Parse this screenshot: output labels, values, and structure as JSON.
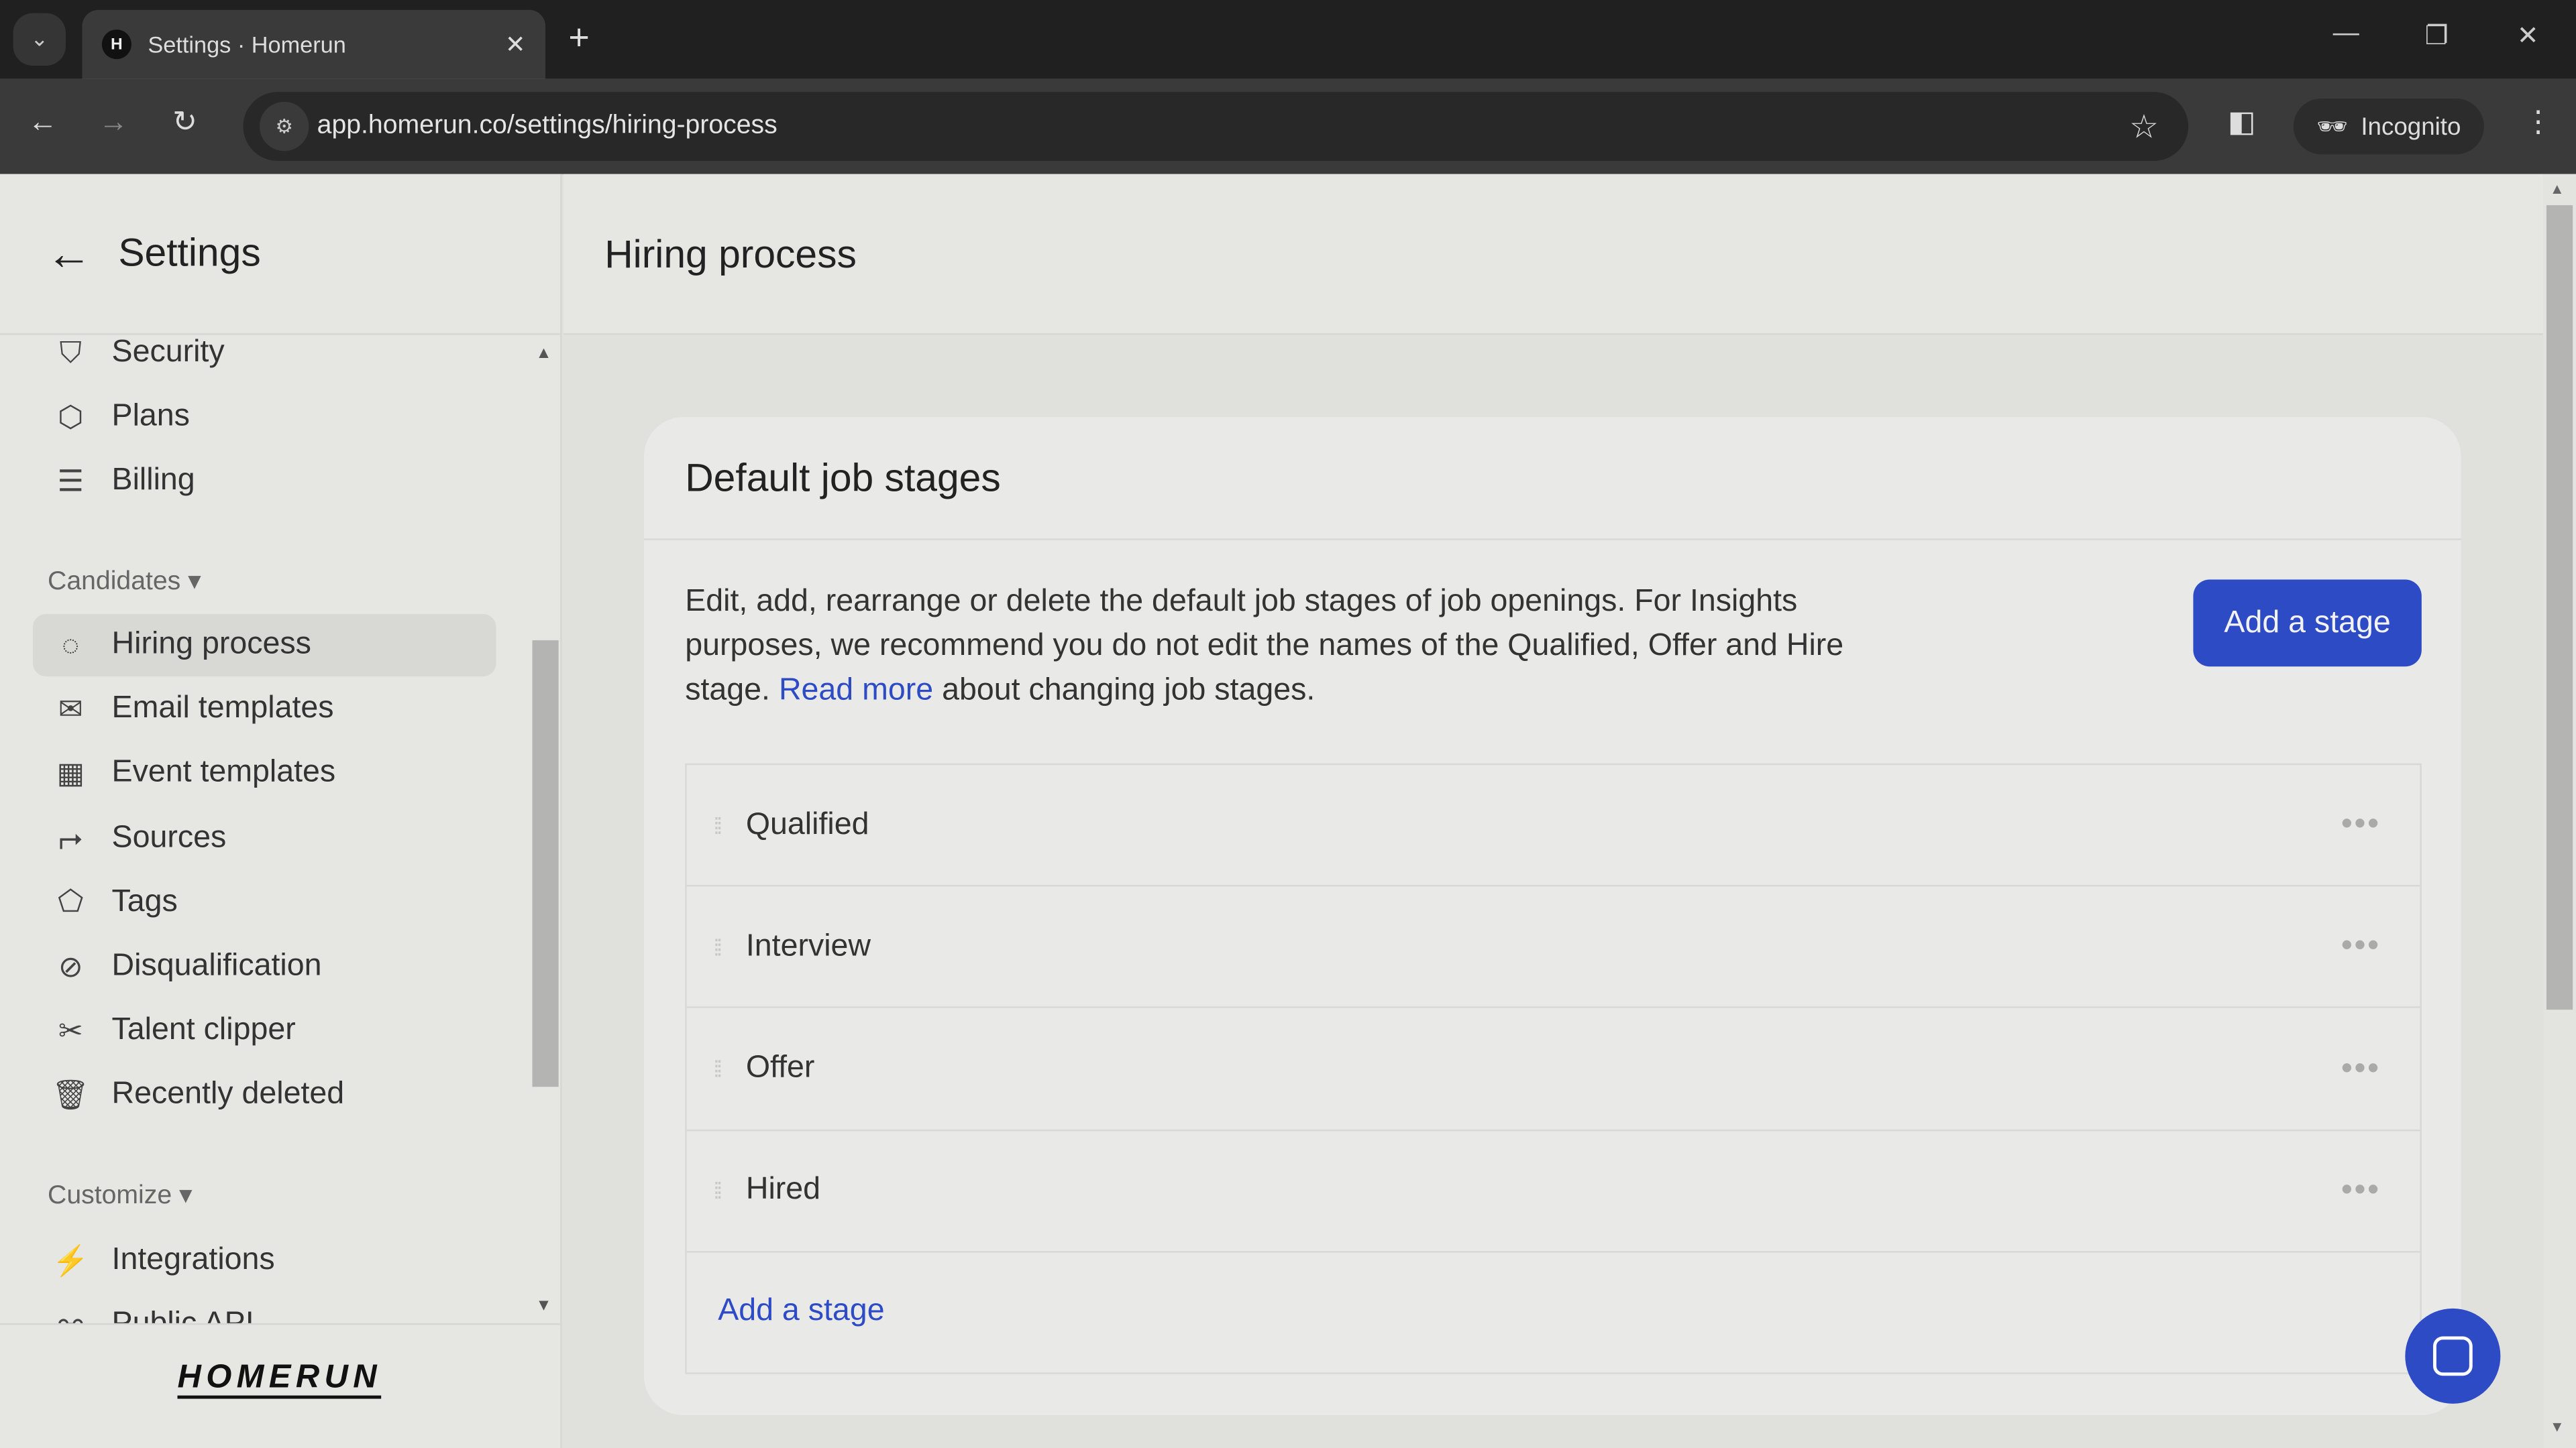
{
  "browser": {
    "tab_title": "Settings · Homerun",
    "favicon": "H",
    "url": "app.homerun.co/settings/hiring-process",
    "incognito_label": "Incognito"
  },
  "sidebar": {
    "title": "Settings",
    "items_top": [
      {
        "label": "Security",
        "icon": "shield-icon"
      },
      {
        "label": "Plans",
        "icon": "box-icon"
      },
      {
        "label": "Billing",
        "icon": "receipt-icon"
      }
    ],
    "group_candidates": "Candidates",
    "items_candidates": [
      {
        "label": "Hiring process",
        "icon": "hiring-icon",
        "active": true
      },
      {
        "label": "Email templates",
        "icon": "mail-icon"
      },
      {
        "label": "Event templates",
        "icon": "calendar-icon"
      },
      {
        "label": "Sources",
        "icon": "source-icon"
      },
      {
        "label": "Tags",
        "icon": "tag-icon"
      },
      {
        "label": "Disqualification",
        "icon": "ban-icon"
      },
      {
        "label": "Talent clipper",
        "icon": "scissors-icon"
      },
      {
        "label": "Recently deleted",
        "icon": "trash-icon"
      }
    ],
    "group_customize": "Customize",
    "items_customize": [
      {
        "label": "Integrations",
        "icon": "plug-icon"
      },
      {
        "label": "Public API",
        "icon": "api-icon"
      }
    ],
    "logo": "HOMERUN"
  },
  "main": {
    "title": "Hiring process",
    "card": {
      "title": "Default job stages",
      "description_before": "Edit, add, rearrange or delete the default job stages of job openings. For Insights purposes, we recommend you do not edit the names of the Qualified, Offer and Hire stage. ",
      "read_more": "Read more",
      "description_after": " about changing job stages.",
      "add_button": "Add a stage",
      "stages": [
        "Qualified",
        "Interview",
        "Offer",
        "Hired"
      ],
      "add_link": "Add a stage"
    }
  },
  "colors": {
    "accent": "#2e4bc6"
  }
}
